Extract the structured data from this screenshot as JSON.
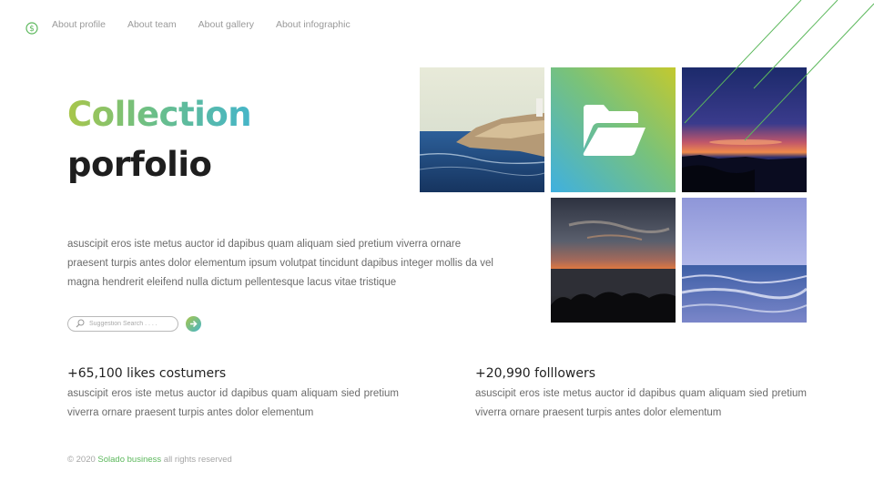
{
  "logo": {
    "icon": "dollar-circle-icon",
    "color": "#5cb85c"
  },
  "nav": {
    "items": [
      "About profile",
      "About team",
      "About gallery",
      "About infographic"
    ]
  },
  "hero": {
    "title_accent": "Collection",
    "title_main": "porfolio",
    "description": "asuscipit eros iste metus auctor id dapibus quam aliquam sied pretium viverra ornare praesent turpis antes dolor elementum ipsum volutpat tincidunt dapibus integer mollis da vel magna hendrerit eleifend nulla dictum pellentesque lacus vitae tristique"
  },
  "search": {
    "placeholder": "Suggestion Search . . . .",
    "value": "",
    "icon": "search-icon",
    "go_icon": "arrow-right-icon"
  },
  "stats": [
    {
      "title": "+65,100 likes costumers",
      "text": "asuscipit eros iste metus auctor id dapibus quam aliquam sied pretium viverra ornare praesent turpis antes dolor elementum"
    },
    {
      "title": "+20,990 folllowers",
      "text": "asuscipit eros iste metus auctor id dapibus quam aliquam sied pretium viverra ornare praesent turpis antes dolor elementum"
    }
  ],
  "footer": {
    "copyright": "© 2020",
    "brand": "Solado business",
    "rights": "all rights reserved"
  },
  "gallery": {
    "folder_icon": "folder-open-icon",
    "accent_colors": [
      "#3fb0e0",
      "#79c27a",
      "#c3c92f"
    ]
  }
}
